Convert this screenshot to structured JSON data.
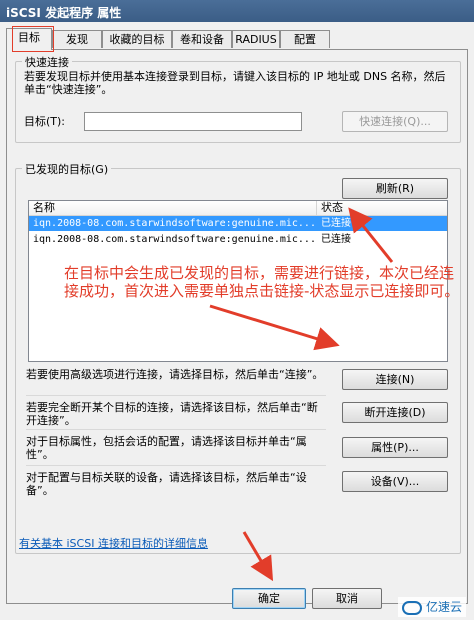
{
  "window": {
    "title": "iSCSI 发起程序 属性"
  },
  "tabs": [
    {
      "label": "目标",
      "active": true
    },
    {
      "label": "发现"
    },
    {
      "label": "收藏的目标"
    },
    {
      "label": "卷和设备"
    },
    {
      "label": "RADIUS"
    },
    {
      "label": "配置"
    }
  ],
  "quick_connect": {
    "title": "快速连接",
    "description": "若要发现目标并使用基本连接登录到目标，请键入该目标的 IP 地址或 DNS 名称，然后单击“快速连接”。",
    "target_label": "目标(T):",
    "target_value": "",
    "button": "快速连接(Q)..."
  },
  "discovered": {
    "title": "已发现的目标(G)",
    "refresh_button": "刷新(R)",
    "columns": {
      "name": "名称",
      "status": "状态"
    },
    "rows": [
      {
        "name": "iqn.2008-08.com.starwindsoftware:genuine.mic...",
        "status": "已连接"
      },
      {
        "name": "iqn.2008-08.com.starwindsoftware:genuine.mic...",
        "status": "已连接"
      }
    ]
  },
  "actions": [
    {
      "text": "若要使用高级选项进行连接，请选择目标，然后单击“连接”。",
      "button": "连接(N)"
    },
    {
      "text": "若要完全断开某个目标的连接，请选择该目标，然后单击“断开连接”。",
      "button": "断开连接(D)"
    },
    {
      "text": "对于目标属性，包括会话的配置，请选择该目标并单击“属性”。",
      "button": "属性(P)..."
    },
    {
      "text": "对于配置与目标关联的设备，请选择该目标，然后单击“设备”。",
      "button": "设备(V)..."
    }
  ],
  "help_link": "有关基本 iSCSI 连接和目标的详细信息",
  "annotation": "在目标中会生成已发现的目标，需要进行链接，本次已经连接成功，首次进入需要单独点击链接-状态显示已连接即可。",
  "footer": {
    "ok": "确定",
    "cancel": "取消"
  },
  "watermark": "亿速云",
  "colors": {
    "annotation": "#e23d2a",
    "selection": "#3399ff",
    "link": "#0a5bb8"
  }
}
